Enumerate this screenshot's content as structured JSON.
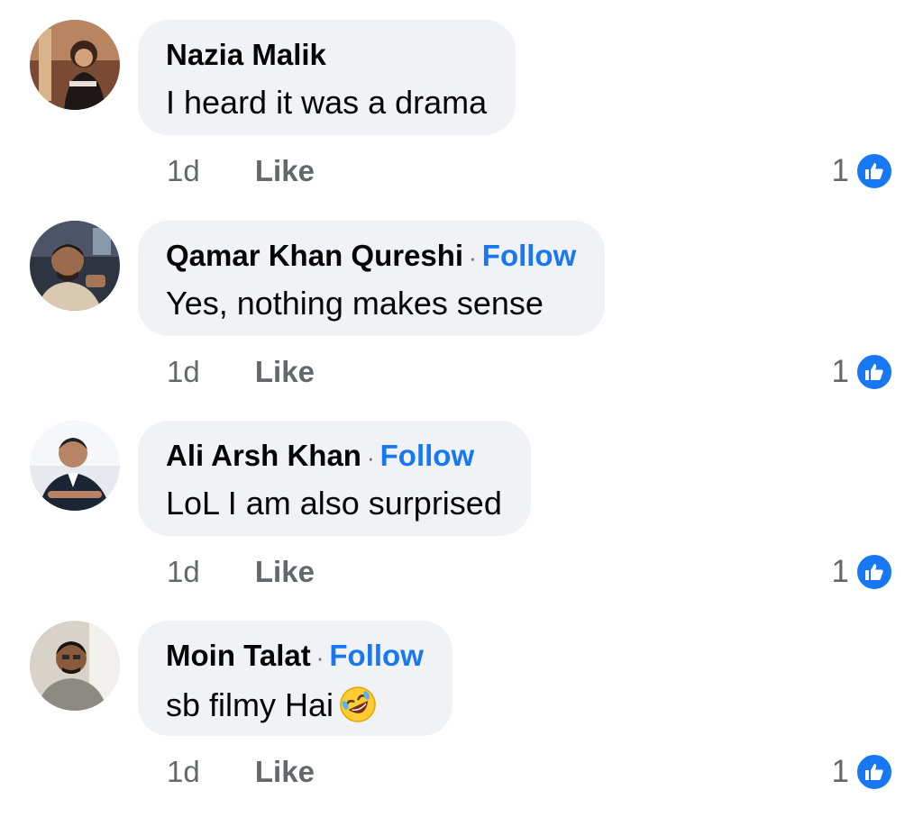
{
  "comments": [
    {
      "author": "Nazia Malik",
      "follow": "",
      "text": "I heard it was a drama",
      "time": "1d",
      "like_label": "Like",
      "reaction_count": "1",
      "emoji": ""
    },
    {
      "author": "Qamar Khan Qureshi",
      "follow": "Follow",
      "text": "Yes, nothing makes sense",
      "time": "1d",
      "like_label": "Like",
      "reaction_count": "1",
      "emoji": ""
    },
    {
      "author": "Ali Arsh Khan",
      "follow": "Follow",
      "text": "LoL I am also surprised",
      "time": "1d",
      "like_label": "Like",
      "reaction_count": "1",
      "emoji": ""
    },
    {
      "author": "Moin Talat",
      "follow": "Follow",
      "text": "sb filmy Hai",
      "time": "1d",
      "like_label": "Like",
      "reaction_count": "1",
      "emoji": "rolling-on-floor-laughing-emoji"
    }
  ],
  "colors": {
    "bubble": "#f0f2f5",
    "follow": "#1877f2",
    "like_badge": "#1877f2",
    "meta": "#65676b"
  }
}
